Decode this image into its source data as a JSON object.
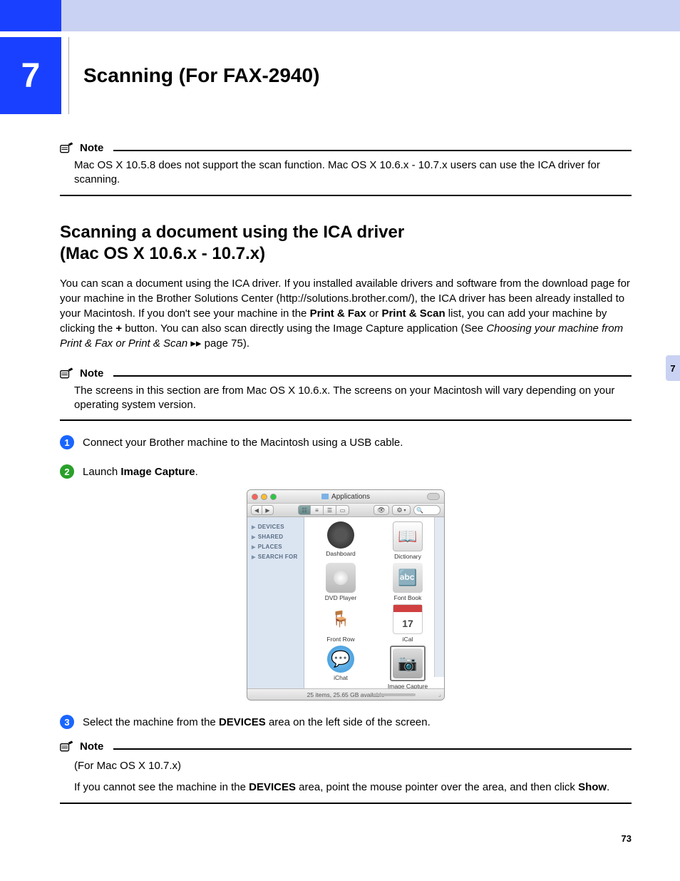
{
  "chapter": {
    "number": "7",
    "title": "Scanning (For FAX-2940)"
  },
  "sideTab": "7",
  "pageNumber": "73",
  "note1": {
    "label": "Note",
    "text": "Mac OS X 10.5.8 does not support the scan function. Mac OS X 10.6.x - 10.7.x users can use the ICA driver for scanning."
  },
  "section": {
    "line1": "Scanning a document using the ICA driver",
    "line2": "(Mac OS X 10.6.x - 10.7.x)"
  },
  "intro": {
    "p1a": "You can scan a document using the ICA driver. If you installed available drivers and software from the download page for your machine in the Brother Solutions Center (http://solutions.brother.com/), the ICA driver has been already installed to your Macintosh. If you don't see your machine in the ",
    "pf1": "Print & Fax",
    "p1b": " or ",
    "pf2": "Print & Scan",
    "p1c": " list, you can add your machine by clicking the ",
    "plus": "+",
    "p1d": " button. You can also scan directly using the Image Capture application (See ",
    "xref": "Choosing your machine from Print & Fax or Print & Scan",
    "p1e": " ▸▸ page 75)."
  },
  "note2": {
    "label": "Note",
    "text": "The screens in this section are from Mac OS X 10.6.x. The screens on your Macintosh will vary depending on your operating system version."
  },
  "steps": {
    "s1": "Connect your Brother machine to the Macintosh using a USB cable.",
    "s2a": "Launch ",
    "s2b": "Image Capture",
    "s2c": ".",
    "s3a": "Select the machine from the ",
    "s3b": "DEVICES",
    "s3c": " area on the left side of the screen."
  },
  "note3": {
    "label": "Note",
    "l1": "(For Mac OS X 10.7.x)",
    "l2a": "If you cannot see the machine in the ",
    "l2b": "DEVICES",
    "l2c": " area, point the mouse pointer over the area, and then click ",
    "l2d": "Show",
    "l2e": "."
  },
  "mac": {
    "title": "Applications",
    "sidebar": [
      "DEVICES",
      "SHARED",
      "PLACES",
      "SEARCH FOR"
    ],
    "apps": [
      {
        "name": "Dashboard"
      },
      {
        "name": "Dictionary"
      },
      {
        "name": "DVD Player"
      },
      {
        "name": "Font Book"
      },
      {
        "name": "Front Row"
      },
      {
        "name": "iCal"
      },
      {
        "name": "iChat"
      },
      {
        "name": "Image Capture"
      }
    ],
    "calDay": "17",
    "status": "25 items, 25.65 GB available"
  }
}
